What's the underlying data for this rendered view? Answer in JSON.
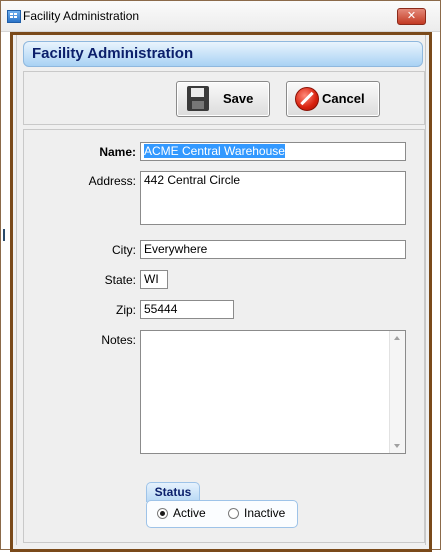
{
  "window": {
    "title": "Facility Administration",
    "close_label": "✕"
  },
  "header": {
    "title": "Facility Administration"
  },
  "toolbar": {
    "save_label": "Save",
    "cancel_label": "Cancel"
  },
  "form": {
    "name_label": "Name:",
    "name_value": "ACME Central Warehouse",
    "address_label": "Address:",
    "address_value": "442 Central Circle",
    "city_label": "City:",
    "city_value": "Everywhere",
    "state_label": "State:",
    "state_value": "WI",
    "zip_label": "Zip:",
    "zip_value": "55444",
    "notes_label": "Notes:",
    "notes_value": ""
  },
  "status": {
    "title": "Status",
    "options": [
      "Active",
      "Inactive"
    ],
    "selected": "Active"
  },
  "colors": {
    "accent": "#a9d2f4",
    "frame": "#7a4a1a",
    "selection": "#3399ff"
  }
}
